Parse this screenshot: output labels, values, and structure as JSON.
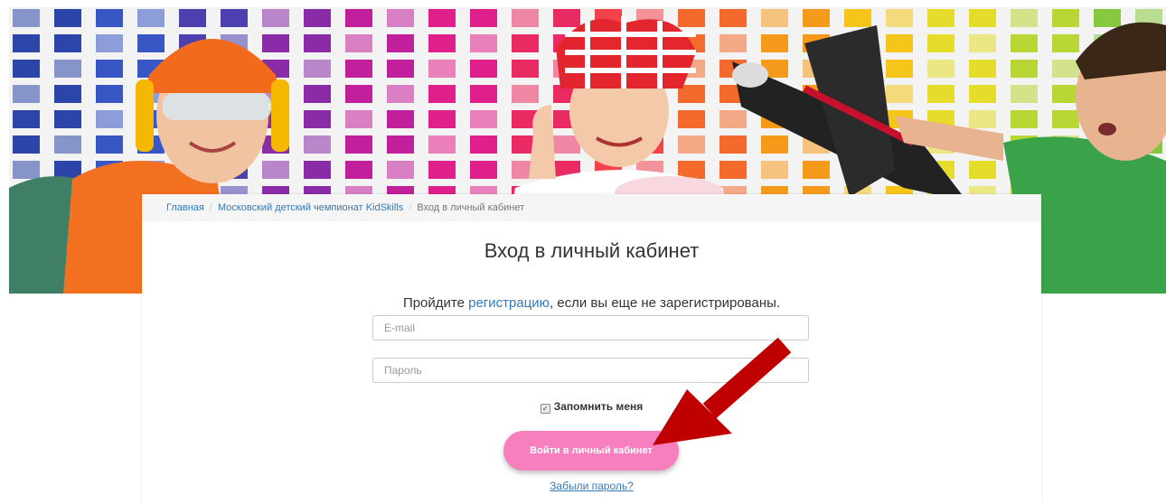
{
  "breadcrumb": {
    "home": "Главная",
    "championship": "Московский детский чемпионат KidSkills",
    "current": "Вход в личный кабинет",
    "separator": "/"
  },
  "login": {
    "title": "Вход в личный кабинет",
    "note_before": "Пройдите ",
    "note_link": "регистрацию",
    "note_after": ", если вы еще не зарегистрированы.",
    "email_placeholder": "E-mail",
    "password_placeholder": "Пароль",
    "remember_label": "Запомнить меня",
    "remember_checked": true,
    "submit_label": "Войти в личный кабинет",
    "forgot_link": "Забыли пароль?"
  },
  "colors": {
    "button": "#f77fbd",
    "link": "#337ab7",
    "arrow": "#c00000"
  }
}
